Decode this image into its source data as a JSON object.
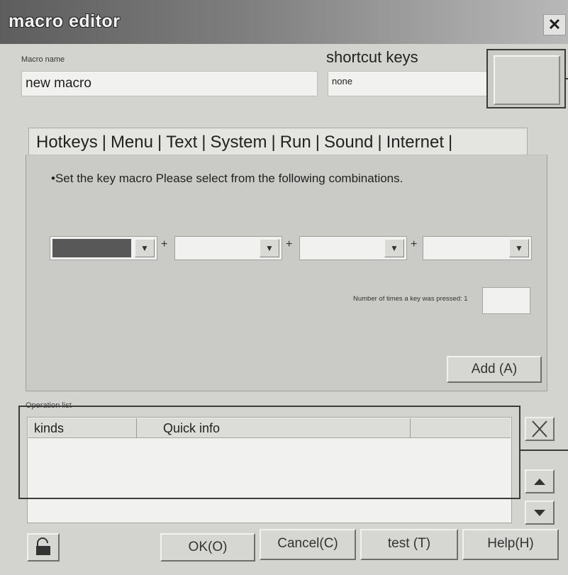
{
  "window": {
    "title": "macro editor",
    "close_glyph": "✕"
  },
  "macro_name": {
    "label": "Macro name",
    "value": "new macro"
  },
  "shortcut": {
    "label": "shortcut keys",
    "value": "none"
  },
  "tabs": [
    {
      "label": "Hotkeys"
    },
    {
      "label": "Menu"
    },
    {
      "label": "Text"
    },
    {
      "label": "System"
    },
    {
      "label": "Run"
    },
    {
      "label": "Sound"
    },
    {
      "label": "Internet"
    }
  ],
  "hotkeys": {
    "instruction": "•Set the key macro Please select from the following combinations.",
    "plus": "+",
    "press_count_label": "Number of times a key was pressed: 1",
    "add_button": "Add (A)"
  },
  "operation_list": {
    "label": "Operation list",
    "columns": [
      "kinds",
      "Quick info"
    ]
  },
  "buttons": {
    "ok": "OK(O)",
    "cancel": "Cancel(C)",
    "test": "test (T)",
    "help": "Help(H)"
  },
  "icons": {
    "close": "close-icon",
    "delete": "x-icon",
    "up": "arrow-up-icon",
    "down": "arrow-down-icon",
    "lock": "lock-icon",
    "dropdown": "chevron-down-icon"
  }
}
